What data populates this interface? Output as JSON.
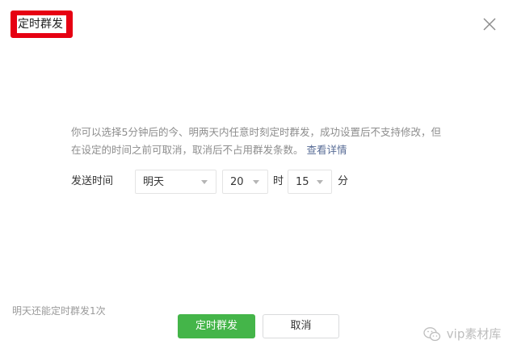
{
  "dialog": {
    "title": "定时群发",
    "close_icon": "close-icon"
  },
  "description": {
    "text": "你可以选择5分钟后的今、明两天内任意时刻定时群发，成功设置后不支持修改，但在设定的时间之前可取消，取消后不占用群发条数。",
    "link": "查看详情"
  },
  "send_time": {
    "label": "发送时间",
    "day": "明天",
    "hour": "20",
    "hour_unit": "时",
    "minute": "15",
    "minute_unit": "分"
  },
  "footer": {
    "remaining_text": "明天还能定时群发1次",
    "confirm_label": "定时群发",
    "cancel_label": "取消"
  },
  "watermark": {
    "text": "vip素材库",
    "icon": "wechat-icon"
  },
  "colors": {
    "primary_green": "#44b549",
    "highlight_red": "#e60012",
    "link_blue": "#576b95"
  }
}
